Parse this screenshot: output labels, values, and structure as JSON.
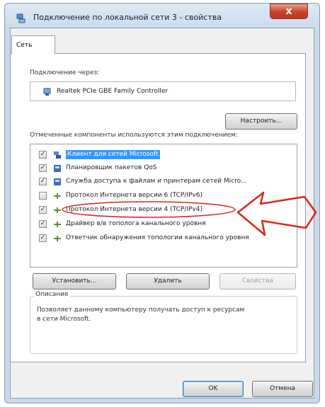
{
  "window": {
    "title": "Подключение по локальной сети 3 - свойства",
    "close_label": "x"
  },
  "tabs": [
    {
      "label": "Сеть",
      "active": true
    }
  ],
  "connect_using": {
    "label": "Подключение через:",
    "adapter": "Realtek PCIe GBE Family Controller",
    "configure_button": "Настроить..."
  },
  "components": {
    "label": "Отмеченные компоненты используются этим подключением:",
    "items": [
      {
        "label": "Клиент для сетей Microsoft",
        "checked": true,
        "selected": true,
        "icon": "network-client-icon"
      },
      {
        "label": "Планировщик пакетов QoS",
        "checked": true,
        "selected": false,
        "icon": "network-service-icon"
      },
      {
        "label": "Служба доступа к файлам и принтерам сетей Micro...",
        "checked": true,
        "selected": false,
        "icon": "network-service-icon"
      },
      {
        "label": "Протокол Интернета версии 6 (TCP/IPv6)",
        "checked": false,
        "selected": false,
        "icon": "protocol-icon"
      },
      {
        "label": "Протокол Интернета версии 4 (TCP/IPv4)",
        "checked": true,
        "selected": false,
        "icon": "protocol-icon"
      },
      {
        "label": "Драйвер в/в тополога канального уровня",
        "checked": true,
        "selected": false,
        "icon": "protocol-icon"
      },
      {
        "label": "Ответчик обнаружения топологии канального уровня",
        "checked": true,
        "selected": false,
        "icon": "protocol-icon"
      }
    ]
  },
  "buttons": {
    "install": "Установить...",
    "remove": "Удалить",
    "properties": "Свойства",
    "ok": "OK",
    "cancel": "Отмена"
  },
  "description": {
    "title": "Описание",
    "text": "Позволяет данному компьютеру получать доступ к ресурсам в сети Microsoft."
  },
  "colors": {
    "selection": "#3399ff",
    "annotation": "#d9261c"
  }
}
